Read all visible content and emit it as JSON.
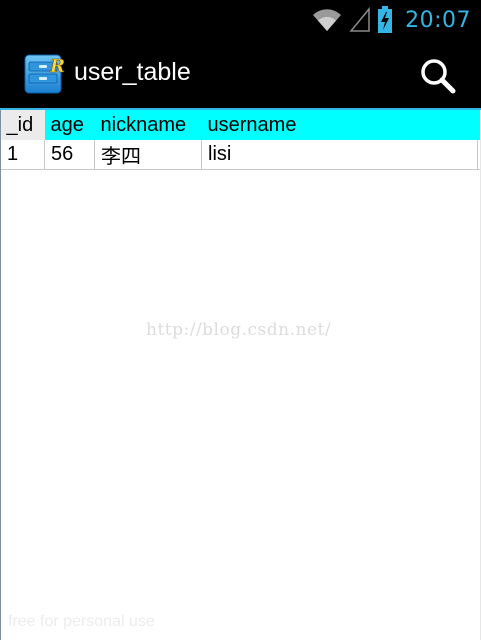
{
  "status_bar": {
    "time": "20:07",
    "wifi_icon": "wifi-icon",
    "signal_icon": "cell-signal-icon",
    "battery_icon": "battery-charging-icon",
    "accent_color": "#33b5e5"
  },
  "action_bar": {
    "title": "user_table",
    "app_icon": "database-cabinet-icon",
    "search_icon": "search-icon"
  },
  "table": {
    "columns": [
      "_id",
      "age",
      "nickname",
      "username"
    ],
    "rows": [
      [
        "1",
        "56",
        "李四",
        "lisi"
      ]
    ],
    "header_color": "#00ffff",
    "id_header_color": "#ebebeb"
  },
  "watermarks": {
    "url": "http://blog.csdn.net/",
    "free": "free for personal use"
  }
}
